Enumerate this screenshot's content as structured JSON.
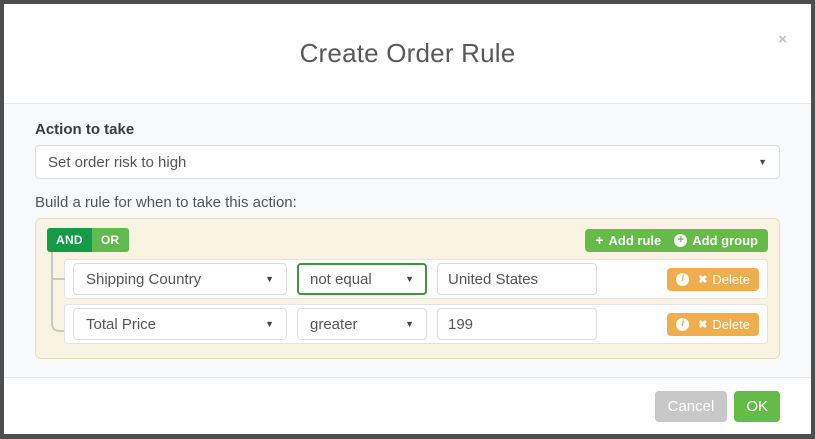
{
  "modal": {
    "title": "Create Order Rule"
  },
  "icons": {
    "close": "×",
    "dropdown_arrow": "▼",
    "plus": "+",
    "circle_plus": "+",
    "info": "i",
    "delete_x": "✖"
  },
  "action_section": {
    "label": "Action to take",
    "selected_option": "Set order risk to high"
  },
  "builder_section": {
    "intro_label": "Build a rule for when to take this action:",
    "group": {
      "and_label": "AND",
      "or_label": "OR",
      "active_condition": "AND",
      "add_rule_label": "Add rule",
      "add_group_label": "Add group",
      "rules": [
        {
          "field": "Shipping Country",
          "operator": "not equal",
          "value": "United States",
          "delete_label": "Delete",
          "operator_highlighted": true
        },
        {
          "field": "Total Price",
          "operator": "greater",
          "value": "199",
          "delete_label": "Delete",
          "operator_highlighted": false
        }
      ]
    }
  },
  "footer": {
    "cancel_label": "Cancel",
    "ok_label": "OK"
  },
  "colors": {
    "and_active": "#149b48",
    "or_inactive": "#5fbb4e",
    "add_button_green": "#64bb47",
    "delete_orange": "#f0ad4e",
    "ok_green": "#64bb47",
    "cancel_gray": "#c8c8c8",
    "operator_highlight_border": "#3c9742",
    "group_background": "#f9f3e1",
    "group_border": "#e6ddb8"
  }
}
